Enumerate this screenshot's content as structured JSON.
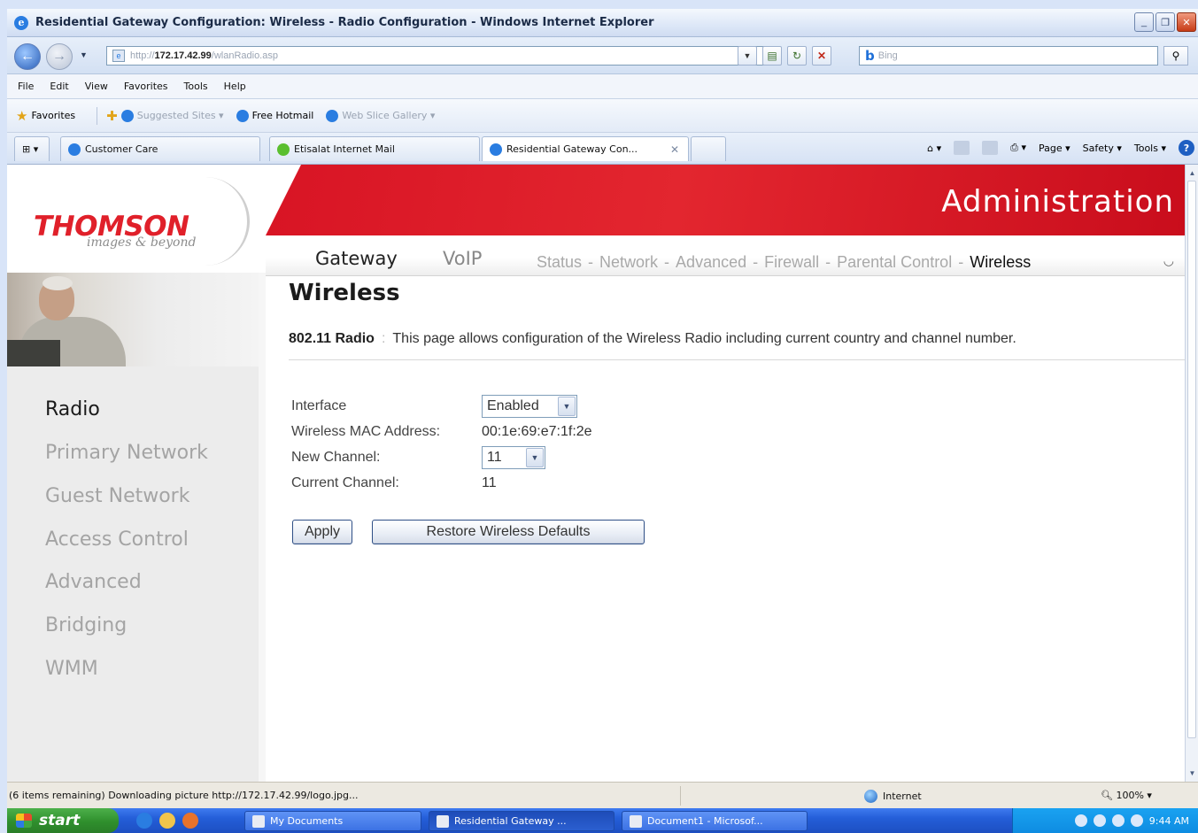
{
  "window": {
    "title": "Residential Gateway Configuration: Wireless - Radio Configuration - Windows Internet Explorer"
  },
  "address_bar": {
    "url_prefix": "http://",
    "url_host": "172.17.42.99",
    "url_path": "/wlanRadio.asp",
    "search_placeholder": "Bing"
  },
  "menu": [
    "File",
    "Edit",
    "View",
    "Favorites",
    "Tools",
    "Help"
  ],
  "favorites_bar": {
    "favorites_label": "Favorites",
    "suggested_sites": "Suggested Sites ▾",
    "free_hotmail": "Free Hotmail",
    "web_slice_gallery": "Web Slice Gallery ▾"
  },
  "tabs": [
    {
      "label": "Customer Care"
    },
    {
      "label": "Etisalat Internet Mail"
    },
    {
      "label": "Residential Gateway Con..."
    }
  ],
  "command_bar": {
    "page": "Page ▾",
    "safety": "Safety ▾",
    "tools": "Tools ▾"
  },
  "header": {
    "brand": "THOMSON",
    "tagline": "images & beyond",
    "admin_title": "Administration",
    "main_nav": [
      "Gateway",
      "VoIP"
    ],
    "sub_nav": [
      "Status",
      "Network",
      "Advanced",
      "Firewall",
      "Parental Control",
      "Wireless"
    ],
    "sub_nav_active": "Wireless"
  },
  "sidebar": {
    "items": [
      "Radio",
      "Primary Network",
      "Guest Network",
      "Access Control",
      "Advanced",
      "Bridging",
      "WMM"
    ],
    "active": "Radio"
  },
  "content": {
    "heading": "Wireless",
    "section_label": "802.11 Radio",
    "section_desc": "This page allows configuration of the Wireless Radio including current country and channel number.",
    "form": {
      "interface_label": "Interface",
      "interface_value": "Enabled",
      "mac_label": "Wireless MAC Address:",
      "mac_value": "00:1e:69:e7:1f:2e",
      "new_channel_label": "New Channel:",
      "new_channel_value": "11",
      "current_channel_label": "Current Channel:",
      "current_channel_value": "11"
    },
    "buttons": {
      "apply": "Apply",
      "restore": "Restore Wireless Defaults"
    }
  },
  "status_bar": {
    "message": "(6 items remaining) Downloading picture http://172.17.42.99/logo.jpg...",
    "zone": "Internet",
    "zoom": "100%"
  },
  "taskbar": {
    "start": "start",
    "buttons": [
      "My Documents",
      "Residential Gateway ...",
      "Document1 - Microsof..."
    ],
    "clock": "9:44 AM"
  },
  "colors": {
    "brand_red": "#e0202a",
    "banner_red": "#d81424",
    "sidebar_bg": "#ececec"
  }
}
